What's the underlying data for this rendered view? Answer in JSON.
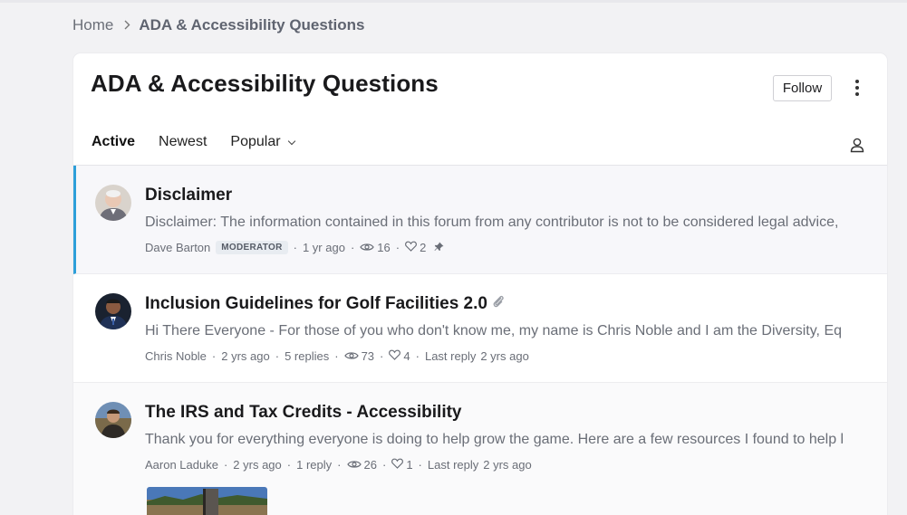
{
  "breadcrumb": {
    "home": "Home",
    "current": "ADA & Accessibility Questions"
  },
  "page": {
    "title": "ADA & Accessibility Questions",
    "follow_label": "Follow"
  },
  "tabs": [
    {
      "label": "Active"
    },
    {
      "label": "Newest"
    },
    {
      "label": "Popular"
    }
  ],
  "topics": [
    {
      "title": "Disclaimer",
      "excerpt": "Disclaimer: The information contained in this forum from any contributor is not to be considered legal advice, exp...",
      "author": "Dave Barton",
      "badge": "MODERATOR",
      "time": "1 yr ago",
      "views": "16",
      "likes": "2"
    },
    {
      "title": "Inclusion Guidelines for Golf Facilities 2.0",
      "excerpt": "Hi There Everyone - For those of you who don't know me, my name is Chris Noble and I am the Diversity, Equity ...",
      "author": "Chris Noble",
      "time": "2 yrs ago",
      "replies": "5 replies",
      "views": "73",
      "likes": "4",
      "last_reply_label": "Last reply",
      "last_reply_time": "2 yrs ago"
    },
    {
      "title": "The IRS and Tax Credits - Accessibility",
      "excerpt": "Thank you for everything everyone is doing to help grow the game. Here are a few resources I found to help busi...",
      "author": "Aaron Laduke",
      "time": "2 yrs ago",
      "replies": "1 reply",
      "views": "26",
      "likes": "1",
      "last_reply_label": "Last reply",
      "last_reply_time": "2 yrs ago"
    }
  ],
  "colors": {
    "accent": "#2d9fd9",
    "muted_text": "#6a6e77",
    "badge_bg": "#e8ecf1"
  }
}
